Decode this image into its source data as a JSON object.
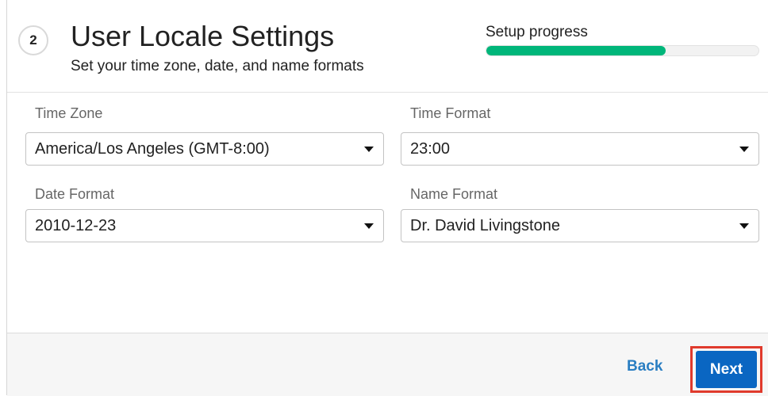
{
  "header": {
    "step_number": "2",
    "title": "User Locale Settings",
    "subtitle": "Set your time zone, date, and name formats",
    "progress_label": "Setup progress",
    "progress_fraction": 0.66,
    "progress_color": "#00b67a"
  },
  "fields": {
    "time_zone": {
      "label": "Time Zone",
      "value": "America/Los Angeles (GMT-8:00)"
    },
    "time_format": {
      "label": "Time Format",
      "value": "23:00"
    },
    "date_format": {
      "label": "Date Format",
      "value": "2010-12-23"
    },
    "name_format": {
      "label": "Name Format",
      "value": "Dr. David Livingstone"
    }
  },
  "footer": {
    "back_label": "Back",
    "next_label": "Next",
    "next_color": "#0a66c2",
    "highlight_color": "#e03a2c"
  }
}
